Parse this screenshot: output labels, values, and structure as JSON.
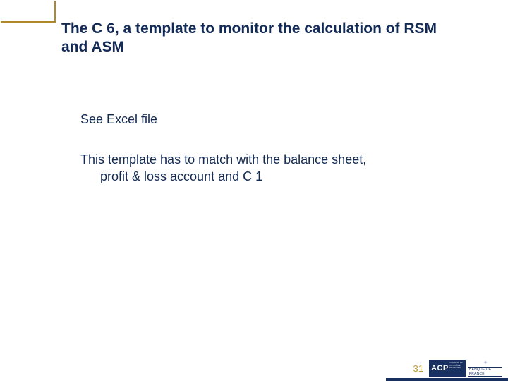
{
  "title": "The C 6, a template to monitor the calculation of RSM and ASM",
  "body": {
    "p1": "See Excel file",
    "p2_line1": "This template has to match with the balance sheet,",
    "p2_line2": "profit & loss account and C 1"
  },
  "footer": {
    "page_number": "31",
    "logo_acp": "ACP",
    "logo_acp_sub": "AUTORITÉ DE CONTRÔLE PRUDENTIEL",
    "logo_bdf": "BANQUE DE FRANCE"
  },
  "colors": {
    "accent_gold": "#b08a2a",
    "brand_navy": "#17305f",
    "text_dark": "#122a55"
  }
}
